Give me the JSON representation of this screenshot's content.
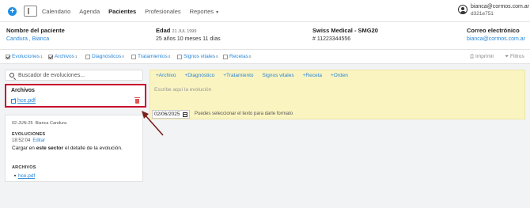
{
  "nav": {
    "plus": "+",
    "links": [
      "Calendario",
      "Agenda",
      "Pacientes",
      "Profesionales",
      "Reportes"
    ],
    "active": "Pacientes",
    "user_email": "bianca@cormos.com.ar",
    "user_id": "d321e751"
  },
  "patient": {
    "name_label": "Nombre del paciente",
    "name_value": "Candura , Bianca",
    "age_label": "Edad",
    "age_date": "21 JUL 1999",
    "age_value": "25 años 10 meses 11 días",
    "insurance_label": "Swiss Medical - SMG20",
    "insurance_value": "# 11223344556",
    "email_label": "Correo electrónico",
    "email_value": "bianca@cormos.com.ar"
  },
  "filters": {
    "items": [
      {
        "label": "Evoluciones",
        "count": "1",
        "checked": true
      },
      {
        "label": "Archivos",
        "count": "1",
        "checked": true
      },
      {
        "label": "Diagnósticos",
        "count": "0",
        "checked": false
      },
      {
        "label": "Tratamientos",
        "count": "0",
        "checked": false
      },
      {
        "label": "Signos vitales",
        "count": "0",
        "checked": false
      },
      {
        "label": "Recetas",
        "count": "0",
        "checked": false
      }
    ],
    "print": "Imprimir",
    "filters_label": "Filtros"
  },
  "search": {
    "placeholder": "Buscador de evoluciones..."
  },
  "archivos": {
    "title": "Archivos",
    "file": "hce.pdf"
  },
  "evolution": {
    "date": "02-JUN-25",
    "author": "Bianca Candura",
    "label": "EVOLUCIONES",
    "time": "18:52:04",
    "edit": "Editar",
    "body_pre": "Cargar en ",
    "body_bold": "este sector",
    "body_post": " el detalle de la evolución.",
    "files_label": "ARCHIVOS",
    "file": "hce.pdf"
  },
  "editor": {
    "toolbar": [
      "+Archivo",
      "+Diagnóstico",
      "+Tratamiento",
      "Signos vitales",
      "+Receta",
      "+Orden"
    ],
    "placeholder": "Escribe aquí la evolución",
    "date": "02/06/2025",
    "hint": "Puedes seleccionar el texto para darle formato"
  },
  "colors": {
    "accent": "#2a86d6",
    "highlight_border": "#c8102e",
    "editor_bg": "#faf4c1",
    "arrow": "#7a1f1a"
  }
}
